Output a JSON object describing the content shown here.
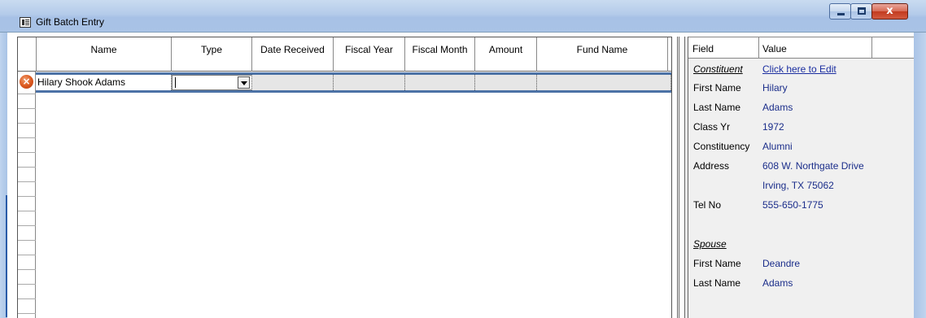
{
  "window": {
    "title": "Gift Batch Entry",
    "icon": "form-icon",
    "buttons": {
      "minimize": "minimize-icon",
      "maximize": "maximize-icon",
      "close_glyph": "x"
    }
  },
  "grid": {
    "columns": [
      "Name",
      "Type",
      "Date Received",
      "Fiscal Year",
      "Fiscal Month",
      "Amount",
      "Fund Name"
    ],
    "rows": [
      {
        "status_icon": "error-icon",
        "status_glyph": "×",
        "name": "Hilary Shook Adams",
        "type": "",
        "date_received": "",
        "fiscal_year": "",
        "fiscal_month": "",
        "amount": "",
        "fund_name": ""
      }
    ]
  },
  "panel": {
    "header": {
      "field": "Field",
      "value": "Value"
    },
    "rows": [
      {
        "field": "Constituent",
        "value": "Click here to Edit",
        "section": true
      },
      {
        "field": "First Name",
        "value": "Hilary"
      },
      {
        "field": "Last Name",
        "value": "Adams"
      },
      {
        "field": "Class Yr",
        "value": "1972"
      },
      {
        "field": "Constituency",
        "value": "Alumni"
      },
      {
        "field": "Address",
        "value": "608 W. Northgate Drive"
      },
      {
        "field": "",
        "value": "Irving, TX 75062"
      },
      {
        "field": "Tel No",
        "value": "555-650-1775"
      },
      {
        "field": "",
        "value": ""
      },
      {
        "field": "Spouse",
        "value": "",
        "section": true
      },
      {
        "field": "First Name",
        "value": "Deandre"
      },
      {
        "field": "Last Name",
        "value": "Adams"
      }
    ]
  },
  "colors": {
    "accent": "#4c72a6",
    "value_text": "#1a2d8a",
    "error": "#dd5a20"
  }
}
